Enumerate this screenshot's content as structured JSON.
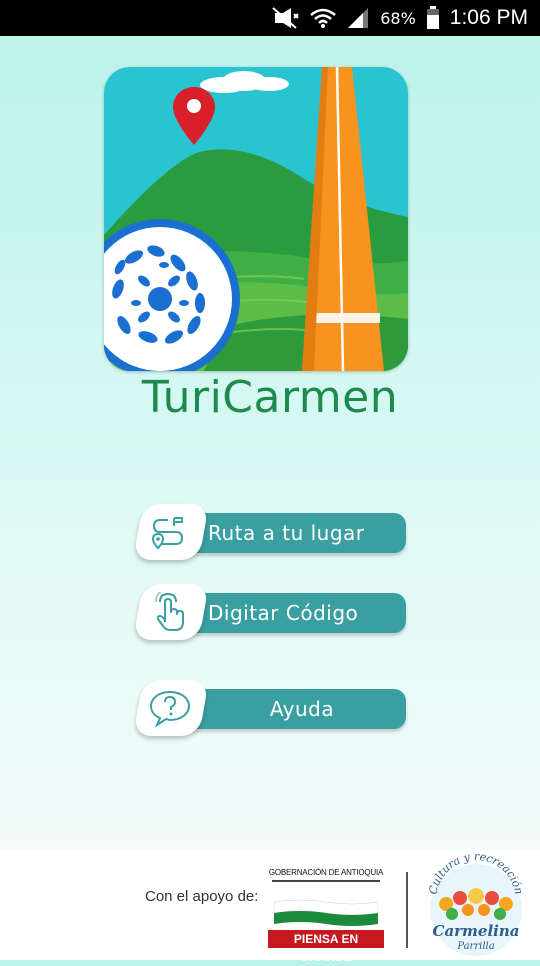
{
  "status_bar": {
    "battery": "68%",
    "time": "1:06 PM",
    "icons": [
      "mute-icon",
      "wifi-icon",
      "signal-icon",
      "battery-icon"
    ]
  },
  "app": {
    "name": "TuriCarmen",
    "logo": "turicarmen-logo"
  },
  "menu": [
    {
      "label": "Ruta a tu lugar",
      "icon": "route-map-icon"
    },
    {
      "label": "Digitar Código",
      "icon": "touch-hand-icon"
    },
    {
      "label": "Ayuda",
      "icon": "help-bubble-icon"
    }
  ],
  "footer": {
    "support_text": "Con el apoyo de:",
    "gov_title": "GOBERNACIÓN DE ANTIOQUIA",
    "gov_slogan": "PIENSA EN GRANDE",
    "partner_arc_text": "Cultura y recreación",
    "partner_name": "Carmelina",
    "partner_surname": "Parrilla"
  },
  "colors": {
    "accent": "#3a9fa1",
    "title_green": "#1f8a4f",
    "road_orange": "#f7931e",
    "badge_red": "#c4191f"
  }
}
